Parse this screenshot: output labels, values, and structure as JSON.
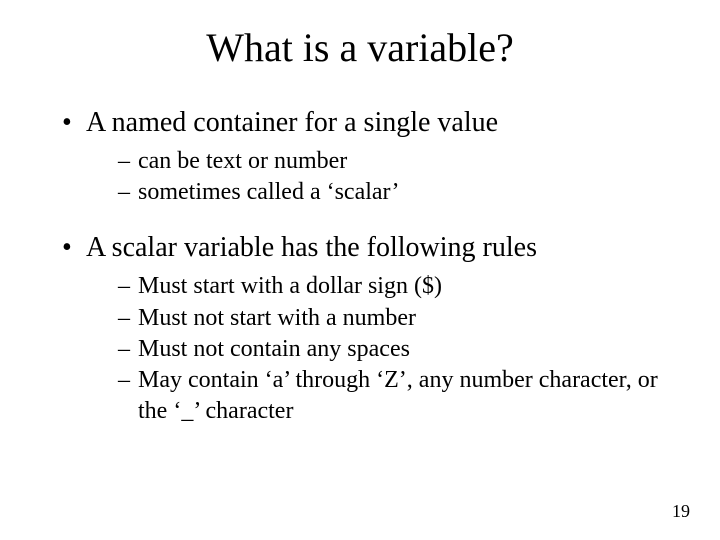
{
  "title": "What is a variable?",
  "bullets": [
    {
      "text": "A named container for a single value",
      "sub": [
        "can be text or number",
        "sometimes called a ‘scalar’"
      ]
    },
    {
      "text": "A scalar variable has the following rules",
      "sub": [
        "Must start with a dollar sign ($)",
        "Must not start with a number",
        "Must not contain any spaces",
        "May contain ‘a’ through ‘Z’, any number character, or the ‘_’ character"
      ]
    }
  ],
  "page_number": "19"
}
